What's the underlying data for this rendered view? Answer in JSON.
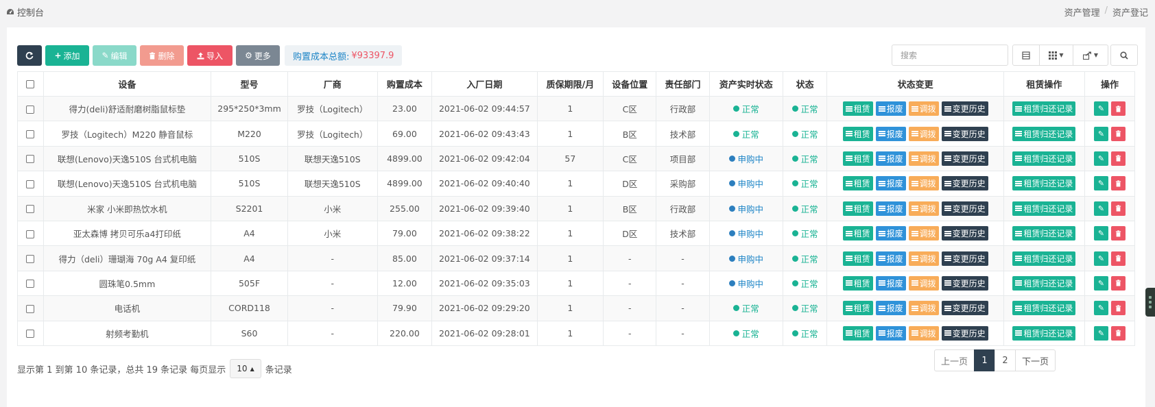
{
  "header": {
    "title": "控制台",
    "breadcrumb": [
      "资产管理",
      "资产登记"
    ]
  },
  "toolbar": {
    "add": "添加",
    "edit": "编辑",
    "delete": "删除",
    "import": "导入",
    "more": "更多",
    "total_label": "购置成本总额:",
    "total_value": "¥93397.9"
  },
  "search": {
    "placeholder": "搜索"
  },
  "table": {
    "headers": [
      "设备",
      "型号",
      "厂商",
      "购置成本",
      "入厂日期",
      "质保期限/月",
      "设备位置",
      "责任部门",
      "资产实时状态",
      "状态",
      "状态变更",
      "租赁操作",
      "操作"
    ],
    "action_labels": {
      "rent": "租赁",
      "scrap": "报废",
      "transfer": "调拨",
      "history": "变更历史",
      "rent_record": "租赁归还记录"
    },
    "rows": [
      {
        "device": "得力(deli)舒适耐磨树脂鼠标垫",
        "model": "295*250*3mm",
        "vendor": "罗技（Logitech）",
        "cost": "23.00",
        "date": "2021-06-02 09:44:57",
        "warranty": "1",
        "location": "C区",
        "dept": "行政部",
        "asset_status": "正常",
        "asset_status_type": "green",
        "status": "正常"
      },
      {
        "device": "罗技（Logitech）M220 静音鼠标",
        "model": "M220",
        "vendor": "罗技（Logitech）",
        "cost": "69.00",
        "date": "2021-06-02 09:43:43",
        "warranty": "1",
        "location": "B区",
        "dept": "技术部",
        "asset_status": "正常",
        "asset_status_type": "green",
        "status": "正常"
      },
      {
        "device": "联想(Lenovo)天逸510S 台式机电脑",
        "model": "510S",
        "vendor": "联想天逸510S",
        "cost": "4899.00",
        "date": "2021-06-02 09:42:04",
        "warranty": "57",
        "location": "C区",
        "dept": "项目部",
        "asset_status": "申购中",
        "asset_status_type": "blue",
        "status": "正常"
      },
      {
        "device": "联想(Lenovo)天逸510S 台式机电脑",
        "model": "510S",
        "vendor": "联想天逸510S",
        "cost": "4899.00",
        "date": "2021-06-02 09:40:40",
        "warranty": "1",
        "location": "D区",
        "dept": "采购部",
        "asset_status": "申购中",
        "asset_status_type": "blue",
        "status": "正常"
      },
      {
        "device": "米家 小米即热饮水机",
        "model": "S2201",
        "vendor": "小米",
        "cost": "255.00",
        "date": "2021-06-02 09:39:40",
        "warranty": "1",
        "location": "B区",
        "dept": "行政部",
        "asset_status": "申购中",
        "asset_status_type": "blue",
        "status": "正常"
      },
      {
        "device": "亚太森博 拷贝可乐a4打印纸",
        "model": "A4",
        "vendor": "小米",
        "cost": "79.00",
        "date": "2021-06-02 09:38:22",
        "warranty": "1",
        "location": "D区",
        "dept": "技术部",
        "asset_status": "申购中",
        "asset_status_type": "blue",
        "status": "正常"
      },
      {
        "device": "得力（deli）珊瑚海 70g A4 复印纸",
        "model": "A4",
        "vendor": "-",
        "cost": "85.00",
        "date": "2021-06-02 09:37:14",
        "warranty": "1",
        "location": "-",
        "dept": "-",
        "asset_status": "申购中",
        "asset_status_type": "blue",
        "status": "正常"
      },
      {
        "device": "圆珠笔0.5mm",
        "model": "505F",
        "vendor": "-",
        "cost": "12.00",
        "date": "2021-06-02 09:35:03",
        "warranty": "1",
        "location": "-",
        "dept": "-",
        "asset_status": "申购中",
        "asset_status_type": "blue",
        "status": "正常"
      },
      {
        "device": "电话机",
        "model": "CORD118",
        "vendor": "-",
        "cost": "79.90",
        "date": "2021-06-02 09:29:20",
        "warranty": "1",
        "location": "-",
        "dept": "-",
        "asset_status": "正常",
        "asset_status_type": "green",
        "status": "正常"
      },
      {
        "device": "射频考勤机",
        "model": "S60",
        "vendor": "-",
        "cost": "220.00",
        "date": "2021-06-02 09:28:01",
        "warranty": "1",
        "location": "-",
        "dept": "-",
        "asset_status": "正常",
        "asset_status_type": "green",
        "status": "正常"
      }
    ]
  },
  "footer": {
    "info": "显示第 1 到第 10 条记录，总共 19 条记录 每页显示",
    "page_size": "10",
    "suffix": "条记录",
    "prev": "上一页",
    "pages": [
      "1",
      "2"
    ],
    "next": "下一页"
  },
  "colors": {
    "primary": "#1ab394",
    "danger": "#ed5565",
    "info": "#1c84c6",
    "dark": "#2f4050",
    "warning": "#f8ac59"
  }
}
